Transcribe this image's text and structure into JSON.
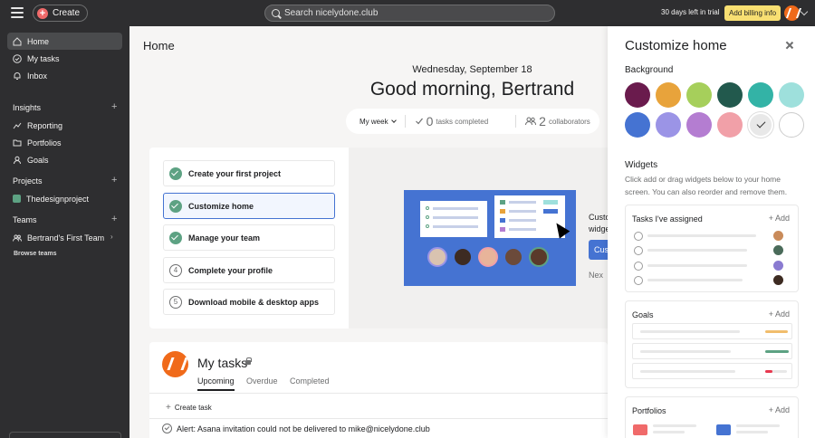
{
  "topbar": {
    "create_label": "Create",
    "search_placeholder": "Search nicelydone.club",
    "trial_text": "30 days left in trial",
    "billing_label": "Add billing info"
  },
  "sidebar": {
    "nav": [
      {
        "label": "Home",
        "icon": "home-icon"
      },
      {
        "label": "My tasks",
        "icon": "check-circle-icon"
      },
      {
        "label": "Inbox",
        "icon": "bell-icon"
      }
    ],
    "insights_title": "Insights",
    "insights": [
      {
        "label": "Reporting",
        "icon": "trend-icon"
      },
      {
        "label": "Portfolios",
        "icon": "folder-icon"
      },
      {
        "label": "Goals",
        "icon": "person-icon"
      }
    ],
    "projects_title": "Projects",
    "projects": [
      {
        "label": "Thedesignproject",
        "color": "#5da283"
      }
    ],
    "teams_title": "Teams",
    "teams": [
      {
        "label": "Bertrand's First Team"
      }
    ],
    "browse_label": "Browse teams"
  },
  "main": {
    "title": "Home",
    "date": "Wednesday, September 18",
    "greeting": "Good morning, Bertrand",
    "stats": {
      "period": "My week",
      "tasks_completed_count": "0",
      "tasks_completed_label": "tasks completed",
      "collaborators_count": "2",
      "collaborators_label": "collaborators"
    },
    "onboarding": [
      {
        "label": "Create your first project",
        "done": true
      },
      {
        "label": "Customize home",
        "done": true,
        "selected": true
      },
      {
        "label": "Manage your team",
        "done": true
      },
      {
        "label": "Complete your profile",
        "done": false,
        "num": "4"
      },
      {
        "label": "Download mobile & desktop apps",
        "done": false,
        "num": "5"
      }
    ],
    "cut_text_1": "Custo",
    "cut_text_2": "widge",
    "cut_btn": "Cus",
    "cut_next": "Nex",
    "my_tasks": {
      "title": "My tasks",
      "tabs": [
        "Upcoming",
        "Overdue",
        "Completed"
      ],
      "create_task": "Create task",
      "alert": "Alert: Asana invitation could not be delivered to mike@nicelydone.club"
    }
  },
  "panel": {
    "title": "Customize home",
    "background_title": "Background",
    "swatches": [
      "#6a1b4d",
      "#e8a33b",
      "#a6cf5b",
      "#22594d",
      "#33b3a6",
      "#9ee0dc",
      "#4573d2",
      "#9b94e6",
      "#b47dd1",
      "#f1a0a8",
      "#e8e8e8",
      "#ffffff"
    ],
    "selected_swatch": 10,
    "widgets_title": "Widgets",
    "widgets_desc": "Click add or drag widgets below to your home screen. You can also reorder and remove them.",
    "widgets": [
      {
        "title": "Tasks I've assigned",
        "add": "Add"
      },
      {
        "title": "Goals",
        "add": "Add"
      },
      {
        "title": "Portfolios",
        "add": "Add"
      }
    ]
  }
}
